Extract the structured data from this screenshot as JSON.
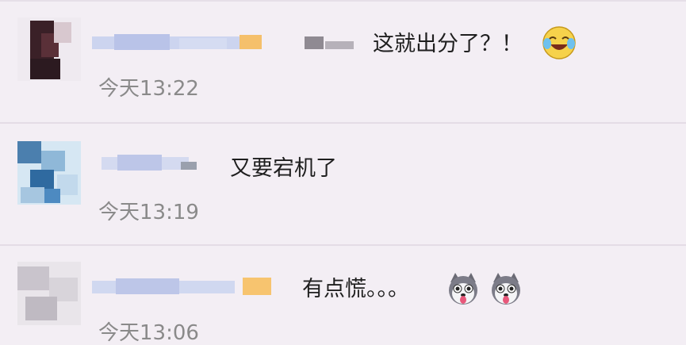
{
  "colors": {
    "background": "#f3eef4",
    "text": "#1f1f1f",
    "time": "#8a8a8a",
    "divider": "#e4dce6"
  },
  "comments": [
    {
      "username_blurred": true,
      "text": "这就出分了？！",
      "emojis": [
        "laughing-crying-emoji"
      ],
      "time": "今天13:22"
    },
    {
      "username_blurred": true,
      "text": "又要宕机了",
      "emojis": [],
      "time": "今天13:19"
    },
    {
      "username_blurred": true,
      "text": "有点慌。。。",
      "emojis": [
        "husky-dog-emoji",
        "husky-dog-emoji"
      ],
      "time": "今天13:06"
    }
  ]
}
